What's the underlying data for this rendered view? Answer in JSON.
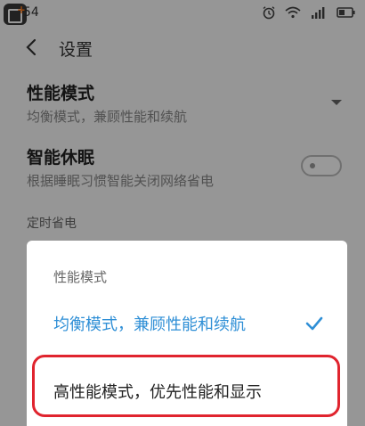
{
  "status_bar": {
    "time": "54",
    "icons": [
      "alarm-icon",
      "wifi-icon",
      "signal-icon",
      "battery-icon"
    ]
  },
  "header": {
    "title": "设置"
  },
  "settings": {
    "performance_mode": {
      "title": "性能模式",
      "subtitle": "均衡模式，兼顾性能和续航"
    },
    "smart_sleep": {
      "title": "智能休眠",
      "subtitle": "根据睡眠习惯智能关闭网络省电",
      "enabled": false
    },
    "scheduled_power_saving": {
      "label": "定时省电"
    }
  },
  "dialog": {
    "title": "性能模式",
    "options": [
      {
        "label": "均衡模式，兼顾性能和续航",
        "selected": true
      },
      {
        "label": "高性能模式，优先性能和显示",
        "selected": false
      }
    ]
  },
  "colors": {
    "accent": "#2f8fd6",
    "highlight_border": "#e0242e",
    "overlay": "rgba(0,0,0,0.40)"
  }
}
